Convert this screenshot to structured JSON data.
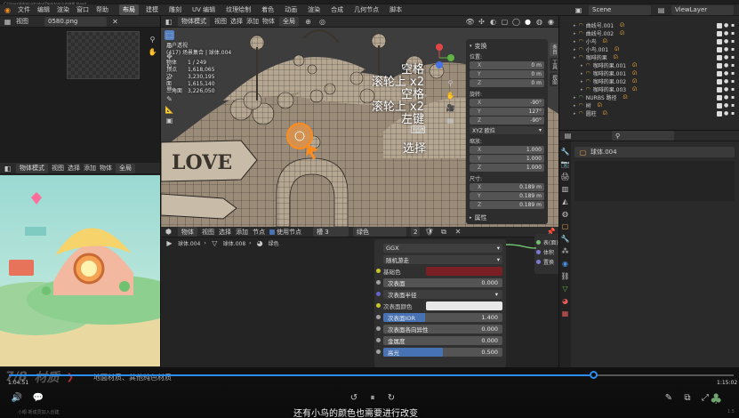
{
  "title_bar": {
    "path": "C:\\Users\\Administrator\\Desktop\\小岛材质.blend"
  },
  "menu": {
    "items": [
      "文件",
      "编辑",
      "渲染",
      "窗口",
      "帮助"
    ],
    "workspace_tabs": [
      "布局",
      "建模",
      "雕刻",
      "UV 编辑",
      "纹理绘制",
      "着色",
      "动画",
      "渲染",
      "合成",
      "几何节点",
      "脚本"
    ],
    "active_tab": "布局",
    "scene": "Scene",
    "view_layer": "ViewLayer"
  },
  "image_editor": {
    "mode": "视图",
    "image_name": "0580.png"
  },
  "render_panel": {
    "mode": "物体模式",
    "view": "视图",
    "select": "选择",
    "add": "添加",
    "object": "物体",
    "global": "全局"
  },
  "viewport": {
    "mode": "物体模式",
    "menus": [
      "视图",
      "选择",
      "添加",
      "物体"
    ],
    "transform": "全局",
    "info_title": "用户透视",
    "info_subtitle": "(417) 场景集合 | 球体.004",
    "stats": [
      {
        "label": "物体",
        "value": "1 / 249"
      },
      {
        "label": "顶点",
        "value": "1,618,065"
      },
      {
        "label": "边",
        "value": "3,230,195"
      },
      {
        "label": "面",
        "value": "1,615,140"
      },
      {
        "label": "三角面",
        "value": "3,226,050"
      }
    ],
    "sign_text": "LOVE",
    "key_hints": [
      "空格",
      "滚轮上 x2",
      "空格",
      "滚轮上 x2",
      "左键"
    ],
    "select_hint": "选择"
  },
  "n_panel": {
    "header": "变换",
    "location_label": "位置:",
    "location": [
      {
        "axis": "X",
        "value": "0 m"
      },
      {
        "axis": "Y",
        "value": "0 m"
      },
      {
        "axis": "Z",
        "value": "0 m"
      }
    ],
    "rotation_label": "旋转:",
    "rotation": [
      {
        "axis": "X",
        "value": "-90°"
      },
      {
        "axis": "Y",
        "value": "127°"
      },
      {
        "axis": "Z",
        "value": "-90°"
      }
    ],
    "rotation_mode": "XYZ 欧拉",
    "scale_label": "缩放:",
    "scale": [
      {
        "axis": "X",
        "value": "1.000"
      },
      {
        "axis": "Y",
        "value": "1.000"
      },
      {
        "axis": "Z",
        "value": "1.000"
      }
    ],
    "dimensions_label": "尺寸:",
    "dimensions": [
      {
        "axis": "X",
        "value": "0.189 m"
      },
      {
        "axis": "Y",
        "value": "0.189 m"
      },
      {
        "axis": "Z",
        "value": "0.189 m"
      }
    ],
    "properties": "属性",
    "tabs": [
      "条目",
      "工具",
      "视图"
    ]
  },
  "outliner": {
    "items": [
      {
        "name": "曲线号.001",
        "indent": 1,
        "color": "#e6a23c"
      },
      {
        "name": "曲线号.002",
        "indent": 1,
        "color": "#e6a23c"
      },
      {
        "name": "小鸟",
        "indent": 1,
        "color": "#e6a23c"
      },
      {
        "name": "小鸟.001",
        "indent": 1,
        "color": "#e6a23c"
      },
      {
        "name": "咖啡的果",
        "indent": 1,
        "color": "#e6a23c"
      },
      {
        "name": "咖啡的果.001",
        "indent": 2,
        "color": "#e6a23c"
      },
      {
        "name": "咖啡的果.001",
        "indent": 2,
        "color": "#e6a23c"
      },
      {
        "name": "咖啡的果.002",
        "indent": 2,
        "color": "#e6a23c"
      },
      {
        "name": "咖啡的果.003",
        "indent": 2,
        "color": "#e6a23c"
      },
      {
        "name": "NURBS 路径",
        "indent": 1,
        "color": "#6fc26f"
      },
      {
        "name": "树",
        "indent": 1,
        "color": "#e6a23c"
      },
      {
        "name": "圆柱",
        "indent": 1,
        "color": "#e6a23c"
      }
    ]
  },
  "properties_panel": {
    "object_name": "球体.004"
  },
  "node_editor": {
    "menus": [
      "物体",
      "视图",
      "选择",
      "添加",
      "节点"
    ],
    "use_nodes": "使用节点",
    "slot": "槽 3",
    "material": "绿色",
    "user_count": "2",
    "breadcrumb": [
      "球体.004",
      "球体.008",
      "绿色"
    ],
    "node": {
      "distribution": "GGX",
      "subsurface_method": "随机游走",
      "base_color_label": "基础色",
      "base_color": "#7a1f24",
      "rows": [
        {
          "label": "次表面",
          "value": "0.000",
          "fill": 0,
          "socket": "#a1a1a1"
        },
        {
          "label": "次表面半径",
          "value": "",
          "fill": 0,
          "socket": "#6363c7",
          "dropdown": true
        },
        {
          "label": "次表面颜色",
          "value": "",
          "fill": 0,
          "socket": "#c7c729",
          "swatch": "#e8e8e8"
        },
        {
          "label": "次表面IOR",
          "value": "1.400",
          "fill": 0.35,
          "socket": "#a1a1a1"
        },
        {
          "label": "次表面各向异性",
          "value": "0.000",
          "fill": 0,
          "socket": "#a1a1a1"
        },
        {
          "label": "金属度",
          "value": "0.000",
          "fill": 0,
          "socket": "#a1a1a1"
        },
        {
          "label": "高光",
          "value": "0.500",
          "fill": 0.5,
          "socket": "#a1a1a1"
        }
      ]
    },
    "output_labels": [
      "表(面)",
      "体积",
      "置换"
    ]
  },
  "video_player": {
    "time_current": "1:04:51",
    "time_total": "1:15:02",
    "progress": 0.806,
    "chapter_index": "7/8",
    "chapter_title": "材质",
    "chapter_desc": "地面材质、其他纯色材质",
    "subtitle": "还有小鸟的颜色也需要进行改变",
    "status_left": "小眼·新成员加入创建",
    "status_right": "1.5"
  },
  "colors": {
    "accent": "#4772b3",
    "select": "#ff8c1a",
    "bg": "#303030"
  }
}
